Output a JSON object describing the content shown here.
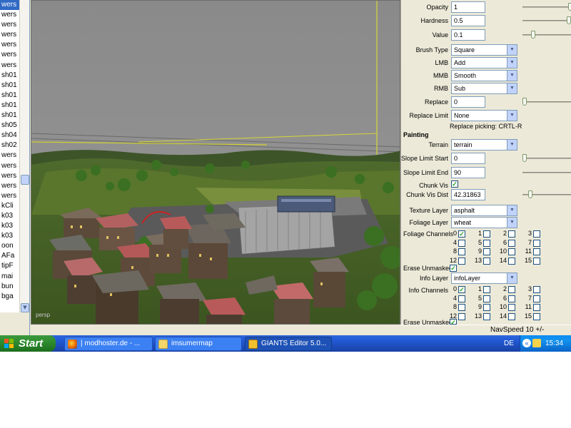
{
  "left_list": {
    "items": [
      "wers",
      "wers",
      "wers",
      "wers",
      "wers",
      "wers",
      "wers",
      "sh01",
      "sh01",
      "sh01",
      "sh01",
      "sh01",
      "sh05",
      "sh04",
      "sh02",
      "wers",
      "wers",
      "wers",
      "wers",
      "wers",
      "kCli",
      "k03",
      "k03",
      "k03",
      "oon",
      "AFa",
      "tipF",
      "mai",
      "bun",
      "bga"
    ]
  },
  "viewport": {
    "label": "persp"
  },
  "props": {
    "opacity": {
      "label": "Opacity",
      "value": "1",
      "slider": 1.0
    },
    "hardness": {
      "label": "Hardness",
      "value": "0.5",
      "slider": 1.0
    },
    "value": {
      "label": "Value",
      "value": "0.1",
      "slider": 0.1
    },
    "brush_type": {
      "label": "Brush Type",
      "value": "Square"
    },
    "lmb": {
      "label": "LMB",
      "value": "Add"
    },
    "mmb": {
      "label": "MMB",
      "value": "Smooth"
    },
    "rmb": {
      "label": "RMB",
      "value": "Sub"
    },
    "replace": {
      "label": "Replace",
      "value": "0",
      "slider": 0.0
    },
    "replace_limit": {
      "label": "Replace Limit",
      "value": "None"
    },
    "replace_hint": "Replace picking: CRTL-R",
    "painting_title": "Painting",
    "terrain": {
      "label": "Terrain",
      "value": "terrain"
    },
    "slope_start": {
      "label": "Slope Limit Start",
      "value": "0",
      "slider": 0.0
    },
    "slope_end": {
      "label": "Slope Limit End",
      "value": "90",
      "slider": 1.0
    },
    "chunk_vis": {
      "label": "Chunk Vis",
      "checked": true
    },
    "chunk_vis_dist": {
      "label": "Chunk Vis Dist",
      "value": "42.31863",
      "slider": 0.1
    },
    "texture_layer": {
      "label": "Texture Layer",
      "value": "asphalt"
    },
    "foliage_layer": {
      "label": "Foliage Layer",
      "value": "wheat"
    },
    "foliage_channels": {
      "label": "Foliage Channels",
      "channels": [
        "0",
        "1",
        "2",
        "3",
        "4",
        "5",
        "6",
        "7",
        "8",
        "9",
        "10",
        "11",
        "12",
        "13",
        "14",
        "15"
      ],
      "checked": [
        true,
        false,
        false,
        false,
        false,
        false,
        false,
        false,
        false,
        false,
        false,
        false,
        false,
        false,
        false,
        false
      ]
    },
    "erase_unmasked": {
      "label": "Erase Unmasked",
      "checked": true
    },
    "info_layer": {
      "label": "Info Layer",
      "value": "infoLayer"
    },
    "info_channels": {
      "label": "Info Channels",
      "channels": [
        "0",
        "1",
        "2",
        "3",
        "4",
        "5",
        "6",
        "7",
        "8",
        "9",
        "10",
        "11",
        "12",
        "13",
        "14",
        "15"
      ],
      "checked": [
        true,
        false,
        false,
        false,
        false,
        false,
        false,
        false,
        false,
        false,
        false,
        false,
        false,
        false,
        false,
        false
      ]
    },
    "erase_unmasked_2": {
      "label": "Erase Unmasked",
      "checked": true
    }
  },
  "statusbar": {
    "navspeed": "NavSpeed 10 +/-"
  },
  "taskbar": {
    "start_label": "Start",
    "tasks": [
      {
        "label": "| modhoster.de - ...",
        "icon": "firefox-icon",
        "active": false
      },
      {
        "label": "imsumermap",
        "icon": "folder-icon",
        "active": false
      },
      {
        "label": "GIANTS Editor 5.0...",
        "icon": "giants-icon",
        "active": true
      }
    ],
    "lang": "DE",
    "clock": "15:34"
  }
}
